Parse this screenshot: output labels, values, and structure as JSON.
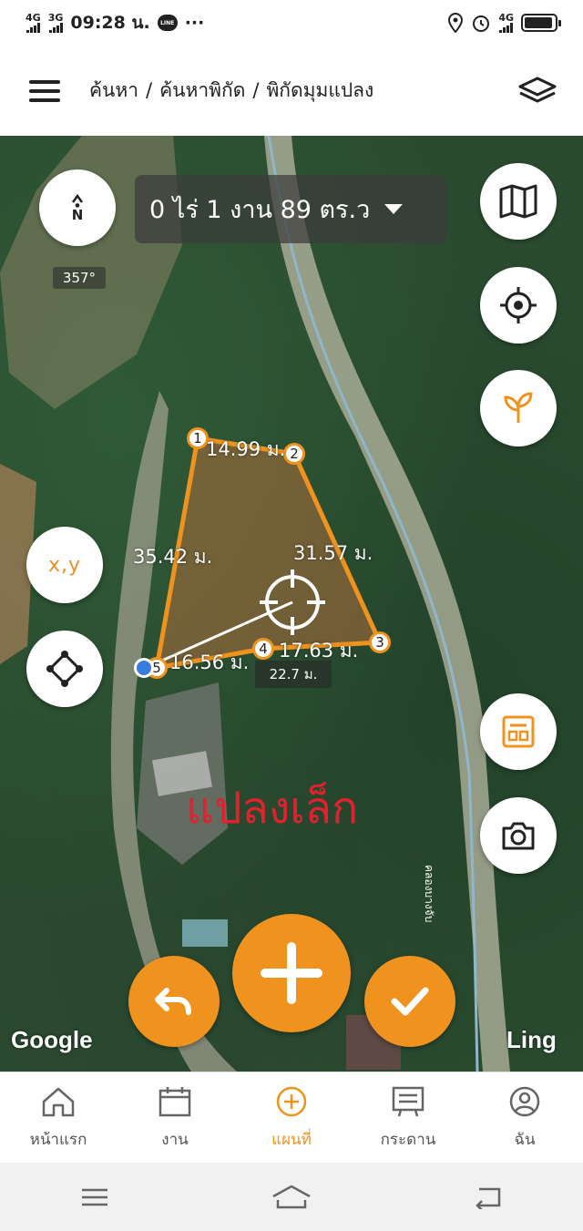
{
  "status_bar": {
    "net1": "4G",
    "net2": "3G",
    "time": "09:28 น.",
    "line_badge": "LINE",
    "more": "···",
    "net3": "4G"
  },
  "header": {
    "breadcrumb": [
      "ค้นหา",
      "ค้นหาพิกัด",
      "พิกัดมุมแปลง"
    ],
    "separator": "/"
  },
  "map": {
    "compass_letter": "N",
    "heading": "357°",
    "area_text": "0 ไร่ 1 งาน 89 ตร.ว",
    "xy_label": "x,y",
    "point_labels": [
      "1",
      "2",
      "3",
      "4",
      "5"
    ],
    "edge_labels": {
      "e12": "14.99 ม.",
      "e23": "31.57 ม.",
      "e34": "17.63 ม.",
      "e45": "16.56 ม.",
      "e51": "35.42 ม."
    },
    "measure_distance": "22.7 ม.",
    "annotation": "แปลงเล็ก",
    "road_name": "คลองบางจับ",
    "attribution_left": "Google",
    "attribution_right": "Ling"
  },
  "bottom_nav": [
    {
      "label": "หน้าแรก",
      "icon": "home-icon"
    },
    {
      "label": "งาน",
      "icon": "calendar-icon"
    },
    {
      "label": "แผนที่",
      "icon": "plus-circle-icon"
    },
    {
      "label": "กระดาน",
      "icon": "board-icon"
    },
    {
      "label": "ฉัน",
      "icon": "user-icon"
    }
  ],
  "colors": {
    "accent": "#f0921e",
    "annotation_red": "#e0212e",
    "polygon_stroke": "#f0921e"
  }
}
